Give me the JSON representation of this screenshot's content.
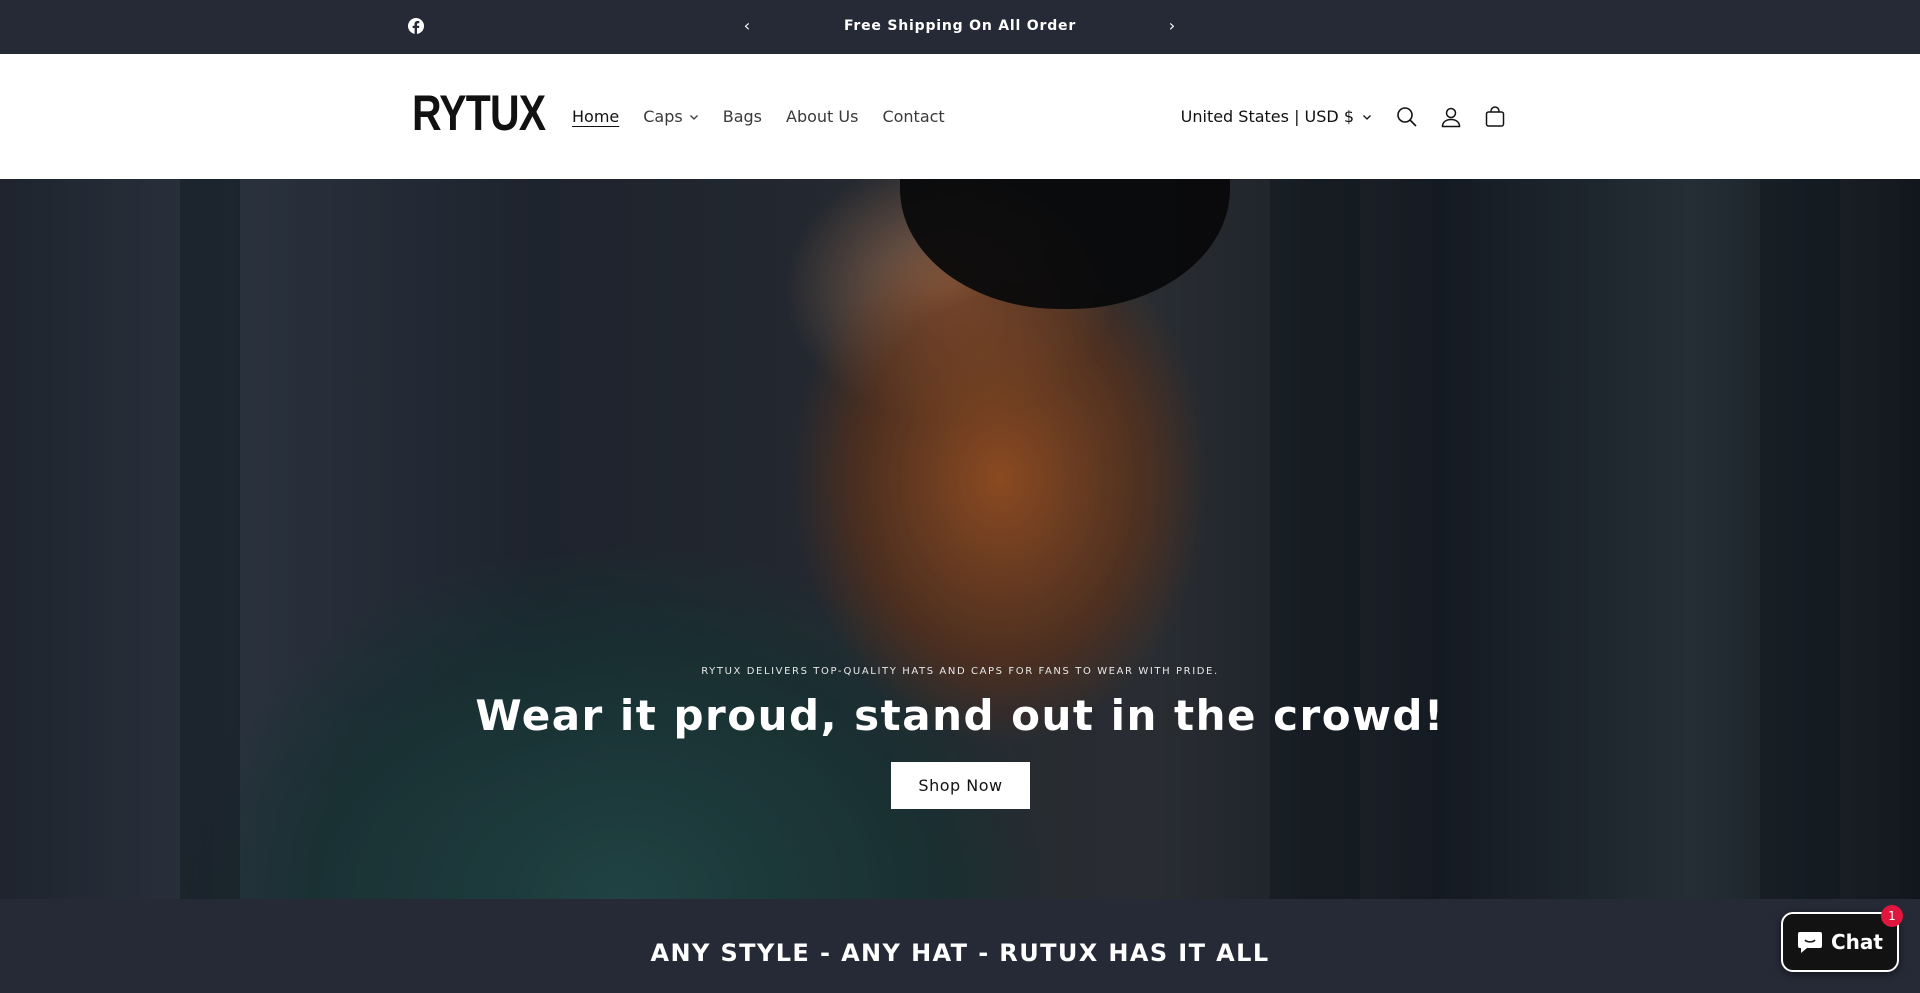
{
  "announcement": {
    "message": "Free Shipping On All Order",
    "prev_arrow": "‹",
    "next_arrow": "›",
    "social_icon": "facebook-icon"
  },
  "header": {
    "logo_text": "RYTUX",
    "nav": [
      {
        "label": "Home",
        "active": true
      },
      {
        "label": "Caps",
        "has_dropdown": true
      },
      {
        "label": "Bags"
      },
      {
        "label": "About Us"
      },
      {
        "label": "Contact"
      }
    ],
    "locale": "United States | USD $",
    "icons": [
      "search-icon",
      "account-icon",
      "cart-icon"
    ]
  },
  "hero": {
    "subheading": "RYTUX DELIVERS TOP-QUALITY HATS AND CAPS FOR FANS TO WEAR WITH PRIDE.",
    "heading": "Wear it proud, stand out in the crowd!",
    "button_label": "Shop Now"
  },
  "band": {
    "heading": "ANY STYLE - ANY HAT - RUTUX HAS IT ALL"
  },
  "chat": {
    "label": "Chat",
    "badge": "1"
  },
  "colors": {
    "dark_band": "#252a36",
    "badge_red": "#e0163f"
  }
}
